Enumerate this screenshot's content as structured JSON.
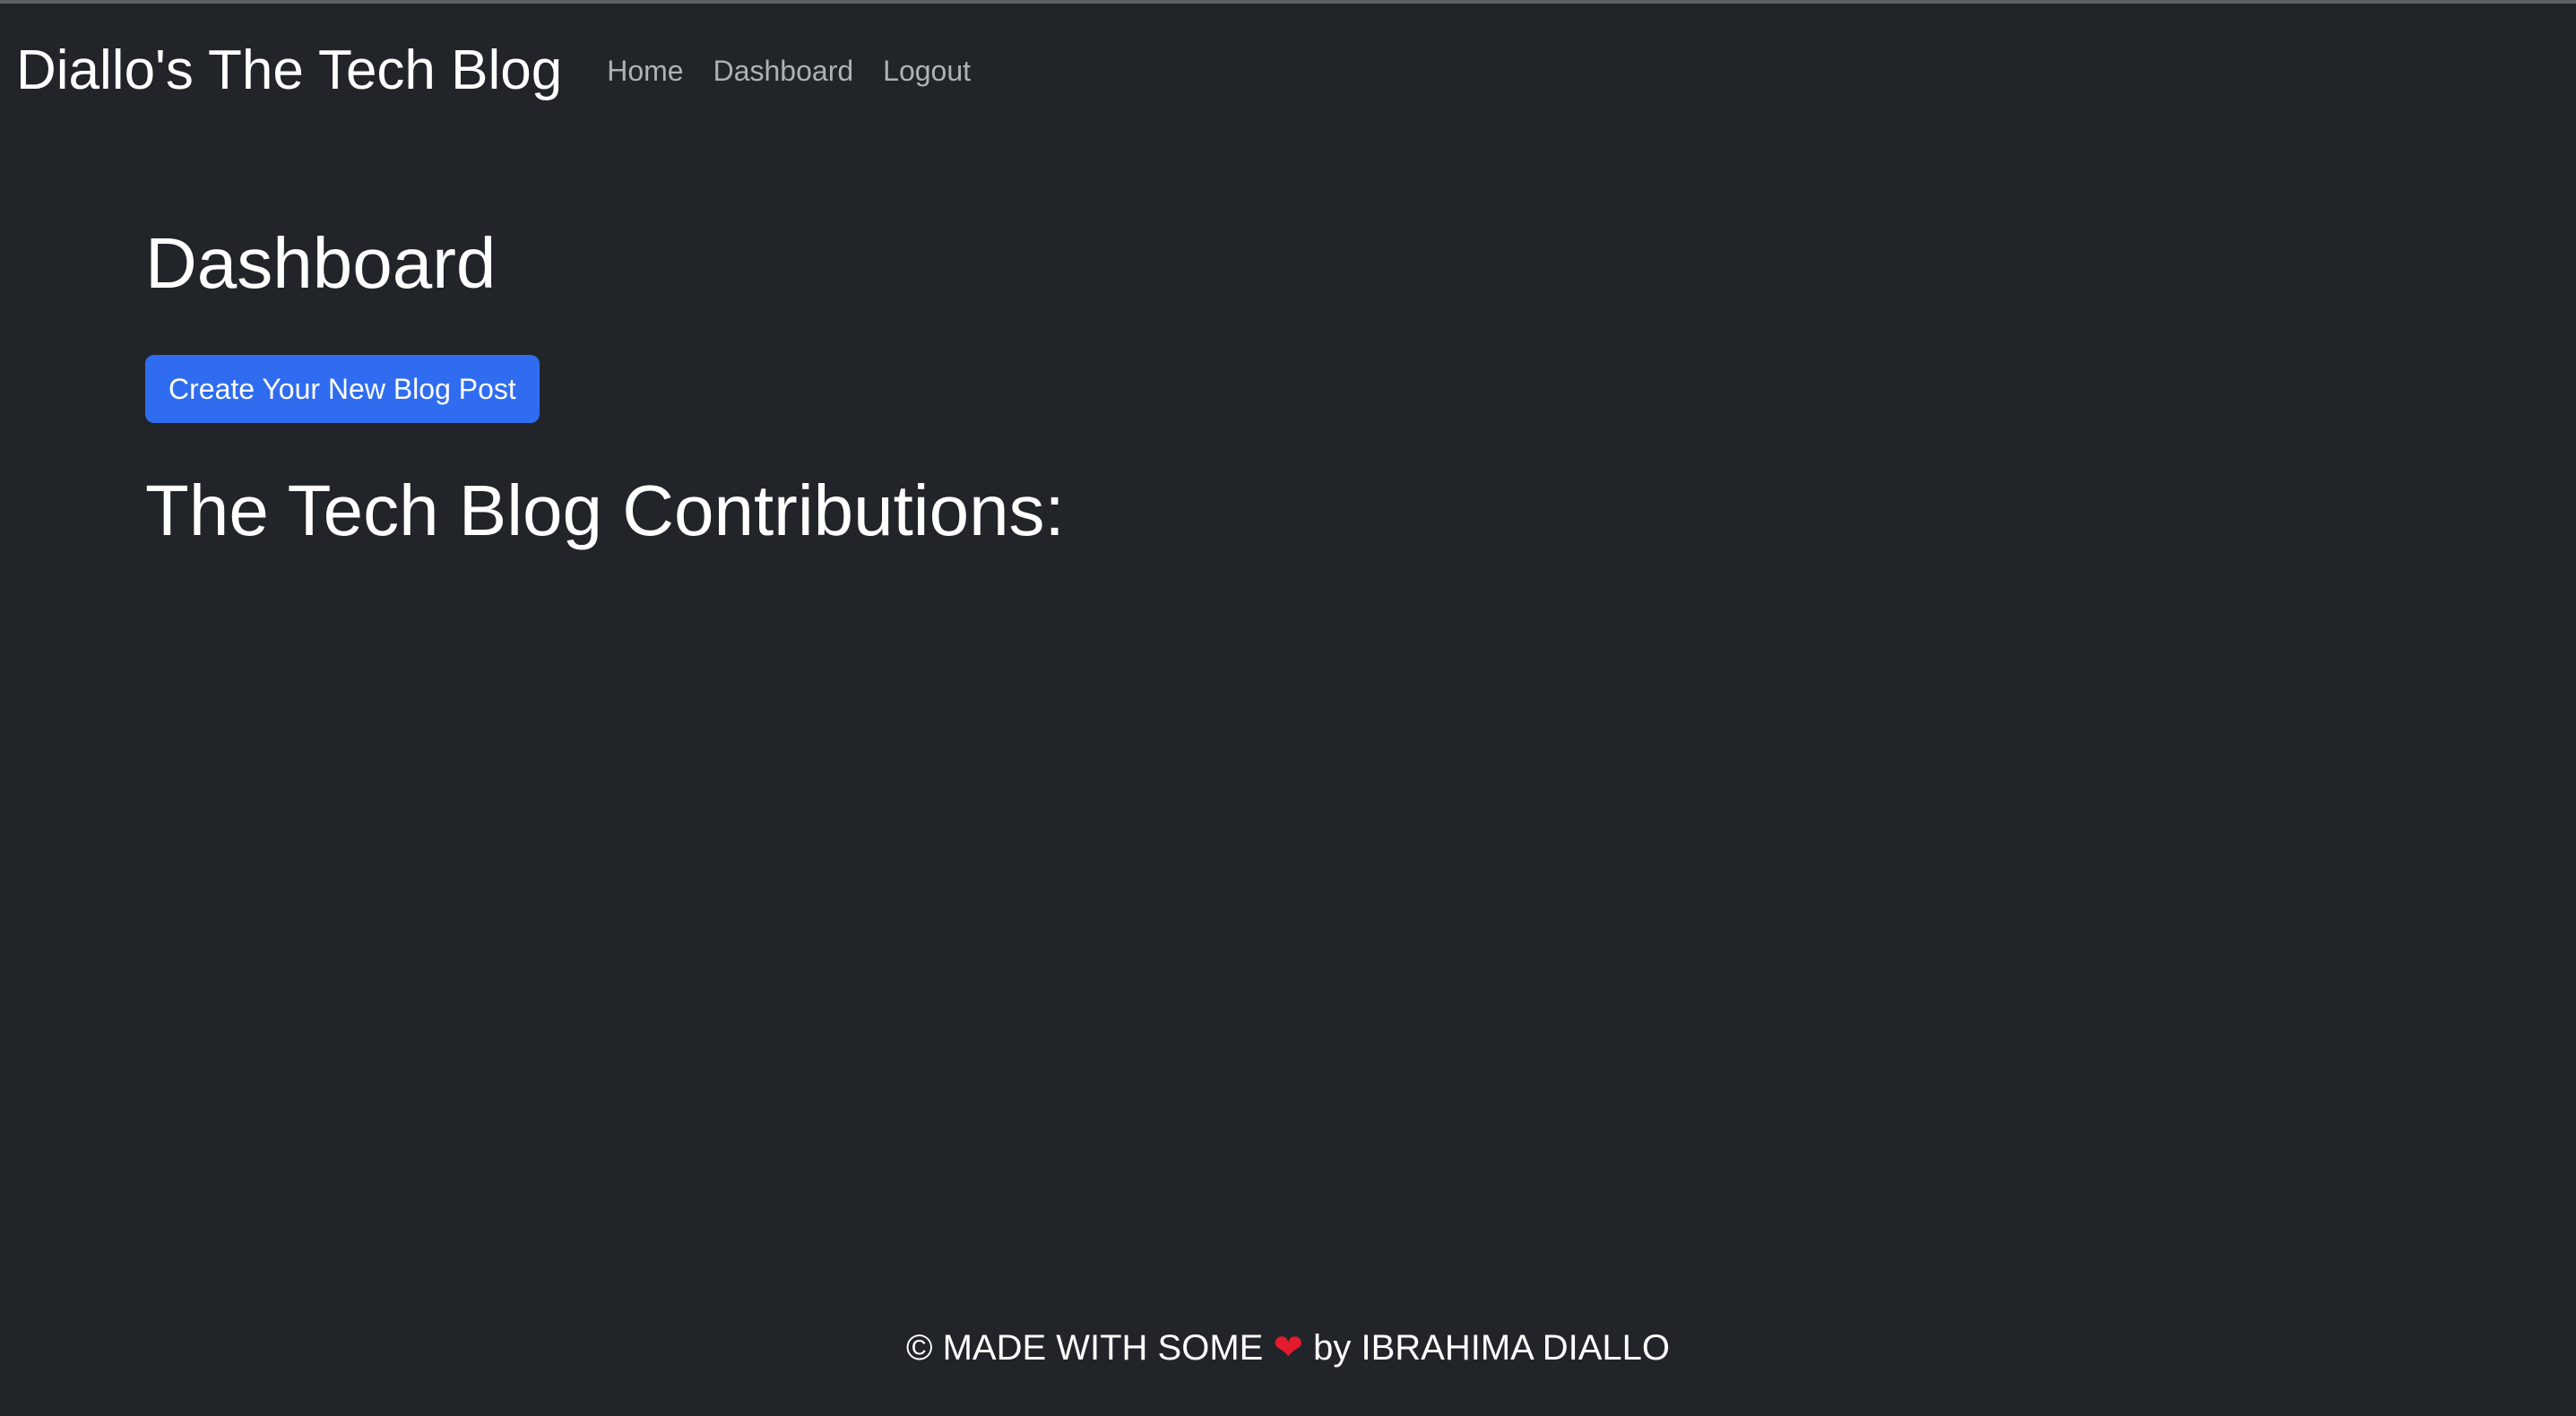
{
  "navbar": {
    "brand": "Diallo's The Tech Blog",
    "links": [
      {
        "label": "Home"
      },
      {
        "label": "Dashboard"
      },
      {
        "label": "Logout"
      }
    ]
  },
  "main": {
    "title": "Dashboard",
    "create_button_label": "Create Your New Blog Post",
    "contributions_title": "The Tech Blog Contributions:"
  },
  "footer": {
    "copyright_symbol": "©",
    "made_with": "MADE WITH SOME",
    "heart_icon": "heart-icon",
    "by_text": "by IBRAHIMA DIALLO"
  },
  "colors": {
    "background": "#212529",
    "button_primary": "#2f6cf0",
    "nav_link": "#aeb2b7",
    "heart": "#e21b2d"
  }
}
